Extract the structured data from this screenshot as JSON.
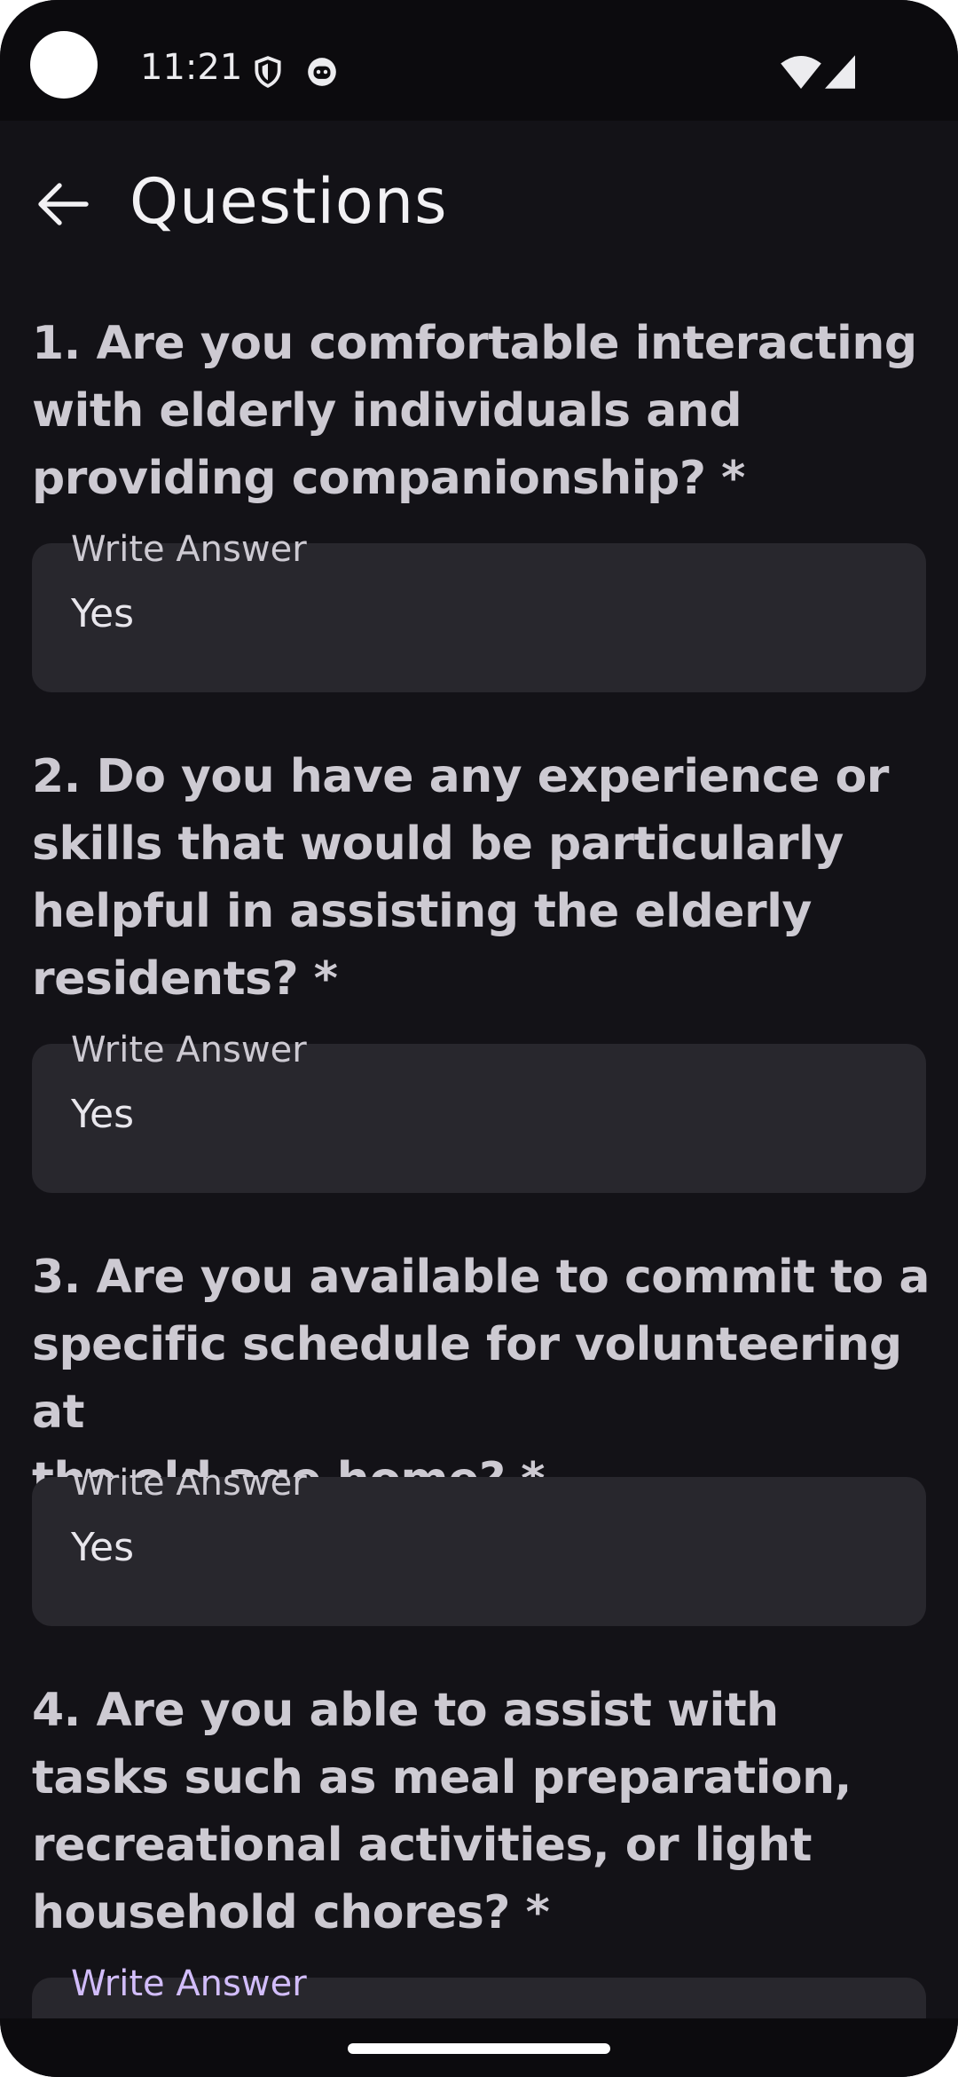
{
  "status_bar": {
    "time": "11:21",
    "icons": [
      "shield-icon",
      "notification-face-icon",
      "wifi-icon",
      "signal-icon"
    ]
  },
  "header": {
    "title": "Questions",
    "back_icon": "arrow-left-icon"
  },
  "questions": [
    {
      "lines": [
        "1. Are you comfortable interacting",
        "with elderly individuals and",
        "providing companionship? *"
      ],
      "label": "Write Answer",
      "answer": "Yes"
    },
    {
      "lines": [
        "2. Do you have any experience or",
        "skills that would be particularly",
        "helpful in assisting the elderly",
        "residents? *"
      ],
      "label": "Write Answer",
      "answer": "Yes"
    },
    {
      "lines": [
        "3. Are you available to commit to a",
        "specific schedule for volunteering at",
        "the old age home? *"
      ],
      "label": "Write Answer",
      "answer": "Yes"
    },
    {
      "lines": [
        "4. Are you able to assist with",
        "tasks such as meal preparation,",
        "recreational activities, or light",
        "household chores? *"
      ],
      "label": "Write Answer",
      "answer": ""
    }
  ],
  "colors": {
    "background": "#131217",
    "field": "#28272d",
    "question_text": "#cdcad2",
    "focused_label": "#d2bdfb"
  }
}
